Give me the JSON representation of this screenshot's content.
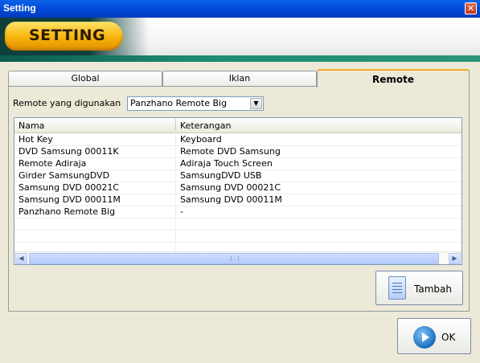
{
  "window": {
    "title": "Setting",
    "close_glyph": "✕"
  },
  "header": {
    "banner_text": "SETTING"
  },
  "tabs": [
    {
      "label": "Global"
    },
    {
      "label": "Iklan"
    },
    {
      "label": "Remote",
      "active": true
    }
  ],
  "remote": {
    "label": "Remote yang digunakan",
    "selected": "Panzhano Remote Big"
  },
  "table": {
    "columns": [
      "Nama",
      "Keterangan"
    ],
    "rows": [
      [
        "Hot Key",
        "Keyboard"
      ],
      [
        "DVD Samsung 00011K",
        "Remote DVD Samsung"
      ],
      [
        "Remote Adiraja",
        "Adiraja Touch Screen"
      ],
      [
        "Girder SamsungDVD",
        "SamsungDVD USB"
      ],
      [
        "Samsung DVD 00021C",
        "Samsung DVD 00021C"
      ],
      [
        "Samsung DVD 00011M",
        "Samsung DVD 00011M"
      ],
      [
        "Panzhano Remote Big",
        "-"
      ]
    ]
  },
  "buttons": {
    "tambah": "Tambah",
    "ok": "OK"
  },
  "icons": {
    "close": "close-icon",
    "dropdown": "chevron-down-icon",
    "add": "document-icon",
    "ok": "arrow-right-icon"
  }
}
